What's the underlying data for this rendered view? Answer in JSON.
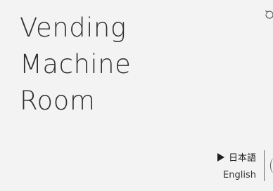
{
  "page": {
    "title_lines": [
      "Vending",
      "Machine",
      "Room"
    ]
  },
  "language": {
    "items": [
      {
        "label": "日本語",
        "active": true
      },
      {
        "label": "English",
        "active": false
      }
    ]
  },
  "icons": {
    "corner": "rotate-icon",
    "edge": "circular-control-icon"
  },
  "colors": {
    "background": "#f3f3f3",
    "text": "#2f2f2f"
  }
}
